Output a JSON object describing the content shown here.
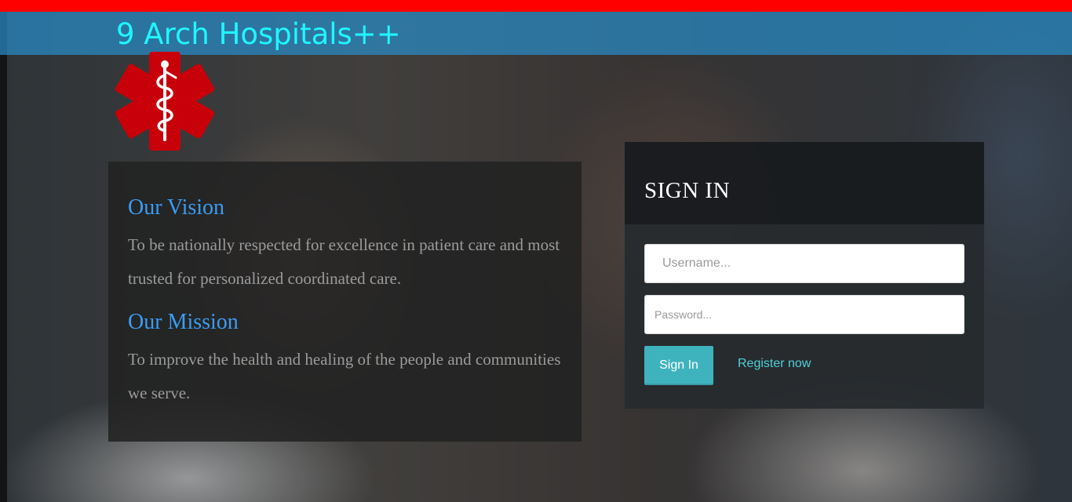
{
  "header": {
    "brand": "9 Arch Hospitals++",
    "logo_icon": "star-of-life-icon",
    "colors": {
      "top_bar": "#ff0000",
      "header_band": "#288cc8",
      "brand_text": "#1ff6ff",
      "logo": "#c8000a"
    }
  },
  "info": {
    "vision_heading": "Our Vision",
    "vision_text": "To be nationally respected for excellence in patient care and most trusted for personalized coordinated care.",
    "mission_heading": "Our Mission",
    "mission_text": "To improve the health and healing of the people and communities we serve.",
    "colors": {
      "heading": "#3b9cf4",
      "text": "#9b9b9b"
    }
  },
  "signin": {
    "title": "SIGN IN",
    "username_placeholder": "Username...",
    "password_placeholder": "Password...",
    "submit_label": "Sign In",
    "register_label": "Register now",
    "colors": {
      "button": "#3fb3bd",
      "link": "#4fcfd9"
    }
  }
}
